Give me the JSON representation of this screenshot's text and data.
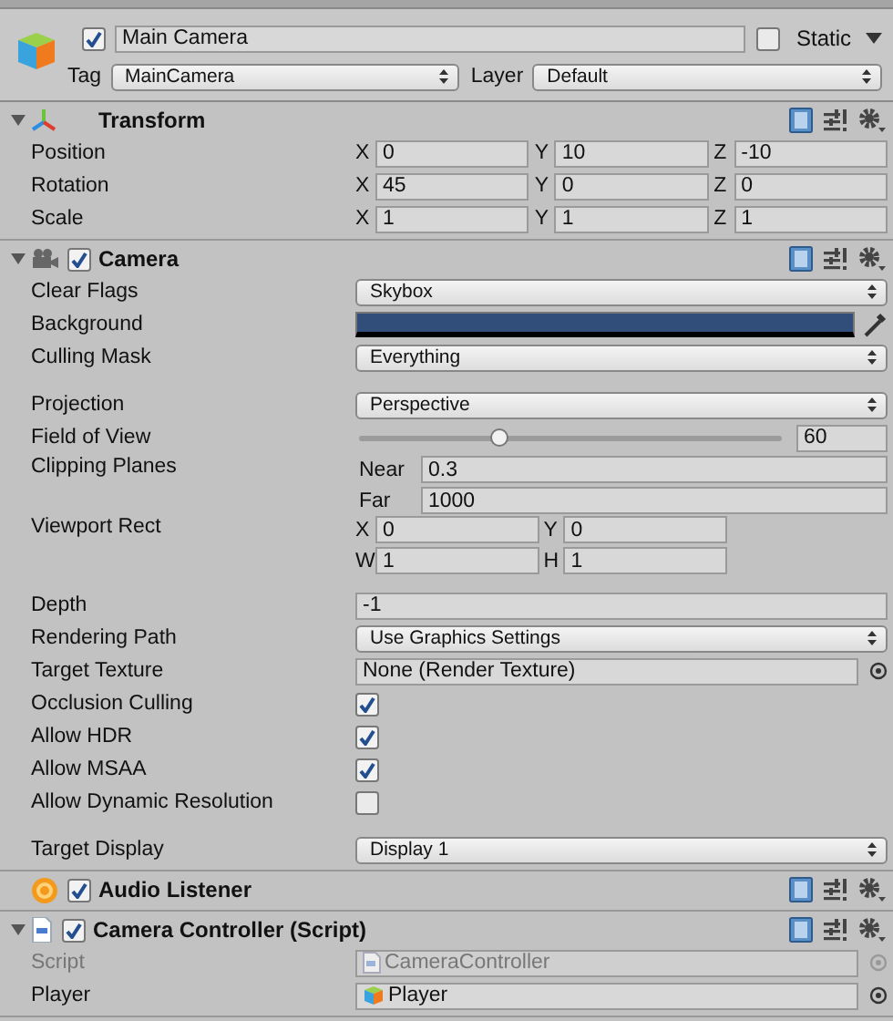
{
  "object": {
    "active": true,
    "name": "Main Camera",
    "static": false,
    "static_label": "Static",
    "tag_label": "Tag",
    "tag": "MainCamera",
    "layer_label": "Layer",
    "layer": "Default"
  },
  "components": [
    {
      "kind": "transform",
      "name": "Transform",
      "expanded": true,
      "properties": [
        {
          "kind": "vector3",
          "label": "Position",
          "axes": [
            {
              "axis": "X",
              "value": "0"
            },
            {
              "axis": "Y",
              "value": "10"
            },
            {
              "axis": "Z",
              "value": "-10"
            }
          ]
        },
        {
          "kind": "vector3",
          "label": "Rotation",
          "axes": [
            {
              "axis": "X",
              "value": "45"
            },
            {
              "axis": "Y",
              "value": "0"
            },
            {
              "axis": "Z",
              "value": "0"
            }
          ]
        },
        {
          "kind": "vector3",
          "label": "Scale",
          "axes": [
            {
              "axis": "X",
              "value": "1"
            },
            {
              "axis": "Y",
              "value": "1"
            },
            {
              "axis": "Z",
              "value": "1"
            }
          ]
        }
      ]
    },
    {
      "kind": "camera",
      "name": "Camera",
      "expanded": true,
      "enabled": true,
      "properties": [
        {
          "kind": "dropdown",
          "label": "Clear Flags",
          "value": "Skybox"
        },
        {
          "kind": "color",
          "label": "Background",
          "color": "#314d79"
        },
        {
          "kind": "dropdown",
          "label": "Culling Mask",
          "value": "Everything"
        },
        {
          "kind": "dropdown",
          "label": "Projection",
          "value": "Perspective",
          "space_before": true
        },
        {
          "kind": "slider",
          "label": "Field of View",
          "level": 0.33,
          "value": "60"
        },
        {
          "kind": "pair",
          "label": "Clipping Planes",
          "fields": [
            {
              "axis": "Near",
              "value": "0.3"
            },
            {
              "axis": "Far",
              "value": "1000"
            }
          ]
        },
        {
          "kind": "rect",
          "label": "Viewport Rect",
          "rows": [
            [
              {
                "axis": "X",
                "value": "0"
              },
              {
                "axis": "Y",
                "value": "0"
              }
            ],
            [
              {
                "axis": "W",
                "value": "1"
              },
              {
                "axis": "H",
                "value": "1"
              }
            ]
          ]
        },
        {
          "kind": "number",
          "label": "Depth",
          "value": "-1",
          "space_before": true
        },
        {
          "kind": "dropdown",
          "label": "Rendering Path",
          "value": "Use Graphics Settings"
        },
        {
          "kind": "object",
          "label": "Target Texture",
          "value": "None (Render Texture)"
        },
        {
          "kind": "checkbox",
          "label": "Occlusion Culling",
          "checked": true
        },
        {
          "kind": "checkbox",
          "label": "Allow HDR",
          "checked": true
        },
        {
          "kind": "checkbox",
          "label": "Allow MSAA",
          "checked": true
        },
        {
          "kind": "checkbox",
          "label": "Allow Dynamic Resolution",
          "checked": false
        },
        {
          "kind": "dropdown",
          "label": "Target Display",
          "value": "Display 1",
          "space_before": true
        }
      ]
    },
    {
      "kind": "audio",
      "name": "Audio Listener",
      "enabled": true
    },
    {
      "kind": "script",
      "name": "Camera Controller (Script)",
      "expanded": true,
      "enabled": true,
      "properties": [
        {
          "kind": "script_ref",
          "label": "Script",
          "value": "CameraController",
          "disabled": true
        },
        {
          "kind": "gameobject_ref",
          "label": "Player",
          "value": "Player"
        }
      ]
    }
  ]
}
